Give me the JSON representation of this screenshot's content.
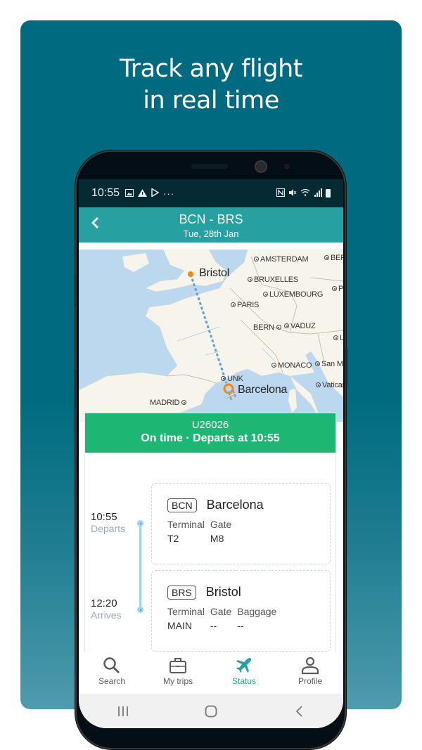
{
  "promo": {
    "headline_line1": "Track any flight",
    "headline_line2": "in real time",
    "background_color": "#006b80"
  },
  "status_bar": {
    "time": "10:55",
    "left_icons": [
      "image-icon",
      "warning-icon",
      "play-store-icon",
      "more-icon"
    ],
    "right_icons": [
      "nfc-icon",
      "mute-icon",
      "wifi-icon",
      "signal-icon",
      "battery-icon"
    ]
  },
  "app_bar": {
    "title": "BCN - BRS",
    "subtitle": "Tue, 28th Jan",
    "back_icon": "chevron-left-icon",
    "color": "#26a0a0"
  },
  "map": {
    "origin": "Barcelona",
    "destination": "Bristol",
    "labels": [
      {
        "name": "AMSTERDAM"
      },
      {
        "name": "BERL"
      },
      {
        "name": "BRUXELLES"
      },
      {
        "name": "LUXEMBOURG"
      },
      {
        "name": "P"
      },
      {
        "name": "PARIS"
      },
      {
        "name": "BERN"
      },
      {
        "name": "VADUZ"
      },
      {
        "name": "L"
      },
      {
        "name": "MONACO"
      },
      {
        "name": "San M"
      },
      {
        "name": "UNK"
      },
      {
        "name": "Vatican"
      },
      {
        "name": "MADRID"
      }
    ]
  },
  "flight_status": {
    "flight_number": "U26026",
    "status_text": "On time · Departs at 10:55",
    "color": "#1db672"
  },
  "departure": {
    "time": "10:55",
    "label": "Departs",
    "code": "BCN",
    "city": "Barcelona",
    "fields": [
      {
        "key": "Terminal",
        "value": "T2"
      },
      {
        "key": "Gate",
        "value": "M8"
      }
    ]
  },
  "arrival": {
    "time": "12:20",
    "label": "Arrives",
    "code": "BRS",
    "city": "Bristol",
    "fields": [
      {
        "key": "Terminal",
        "value": "MAIN"
      },
      {
        "key": "Gate",
        "value": "--"
      },
      {
        "key": "Baggage",
        "value": "--"
      }
    ]
  },
  "bottom_nav": {
    "items": [
      {
        "label": "Search",
        "icon": "search-icon",
        "active": false
      },
      {
        "label": "My trips",
        "icon": "briefcase-icon",
        "active": false
      },
      {
        "label": "Status",
        "icon": "airplane-icon",
        "active": true
      },
      {
        "label": "Profile",
        "icon": "person-icon",
        "active": false
      }
    ],
    "active_color": "#26a0a0"
  },
  "system_nav": {
    "buttons": [
      "recents-icon",
      "home-icon",
      "back-icon"
    ]
  }
}
